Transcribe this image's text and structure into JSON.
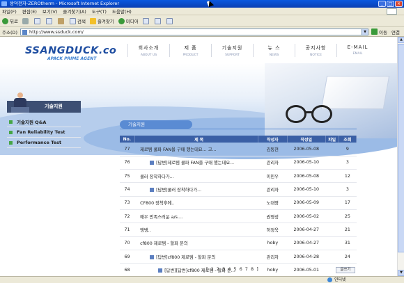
{
  "window": {
    "title": "쌍덕전자-ZEROtherm - Microsoft Internet Explorer"
  },
  "menubar": {
    "items": [
      "파일(F)",
      "편집(E)",
      "보기(V)",
      "즐겨찾기(A)",
      "도구(T)",
      "도움말(H)"
    ]
  },
  "toolbar": {
    "back": "뒤로",
    "search": "검색",
    "favorites": "즐겨찾기",
    "media": "미디어"
  },
  "addressbar": {
    "label": "주소(D)",
    "url": "http://www.ssduck.com/",
    "go": "이동",
    "links": "연결"
  },
  "site": {
    "logo": "SSANGDUCK.co",
    "tagline": "APACK PRIME AGENT",
    "nav": [
      {
        "kr": "회사소개",
        "en": "ABOUT US"
      },
      {
        "kr": "제 품",
        "en": "PRODUCT"
      },
      {
        "kr": "기술지원",
        "en": "SUPPORT"
      },
      {
        "kr": "뉴 스",
        "en": "NEWS"
      },
      {
        "kr": "공지사항",
        "en": "NOTICE"
      },
      {
        "kr": "E-MAIL",
        "en": "EMAIL"
      }
    ],
    "section_tab": "기술지원",
    "left_menu": [
      "기술지원 Q&A",
      "Fan Reliability Test",
      "Performance Test"
    ]
  },
  "board": {
    "title": "기술지원",
    "columns": [
      "No.",
      "제 목",
      "작성자",
      "작성일",
      "파일",
      "조회"
    ],
    "rows": [
      {
        "no": "77",
        "title": "제로템 쿨파 FAN을 구매 했는데요... 고...",
        "author": "김동현",
        "date": "2006-05-08",
        "file": "",
        "views": "9",
        "reply": 0
      },
      {
        "no": "76",
        "title": "[답변]제로템 쿨파 FAN을 구매 했는데요...",
        "author": "관리자",
        "date": "2006-05-10",
        "file": "",
        "views": "3",
        "reply": 1
      },
      {
        "no": "75",
        "title": "쿨러 장착하다가...",
        "author": "이민우",
        "date": "2006-05-08",
        "file": "",
        "views": "12",
        "reply": 0
      },
      {
        "no": "74",
        "title": "[답변]쿨러 장착하다가...",
        "author": "관리자",
        "date": "2006-05-10",
        "file": "",
        "views": "3",
        "reply": 1
      },
      {
        "no": "73",
        "title": "CF800 장착후에..",
        "author": "노대영",
        "date": "2006-05-09",
        "file": "",
        "views": "17",
        "reply": 0
      },
      {
        "no": "72",
        "title": "매우 만족스러운 a/s....",
        "author": "권영성",
        "date": "2006-05-02",
        "file": "",
        "views": "25",
        "reply": 0
      },
      {
        "no": "71",
        "title": "탱뱅..",
        "author": "허정욱",
        "date": "2006-04-27",
        "file": "",
        "views": "21",
        "reply": 0
      },
      {
        "no": "70",
        "title": "cf800 제로템 - 할파 문의",
        "author": "hoby",
        "date": "2006-04-27",
        "file": "",
        "views": "31",
        "reply": 0
      },
      {
        "no": "69",
        "title": "[답변]cf800 제로템 - 할파 문의",
        "author": "관리자",
        "date": "2006-04-28",
        "file": "",
        "views": "24",
        "reply": 1
      },
      {
        "no": "68",
        "title": "[답변][답변]cf800 제로템 - 할파 문...",
        "author": "hoby",
        "date": "2006-05-01",
        "file": "",
        "views": "11",
        "reply": 2
      }
    ],
    "pager": {
      "pages": "[ 1 2 3 4 5 6 7 8 ]",
      "current": "1"
    },
    "write_button": "글쓰기"
  },
  "statusbar": {
    "left": "",
    "zone": "인터넷"
  },
  "colors": {
    "header_bar": "#3a5fa5",
    "accent": "#5a8bd3",
    "logo": "#1f4ea1",
    "menu_dot": "#45a545"
  }
}
